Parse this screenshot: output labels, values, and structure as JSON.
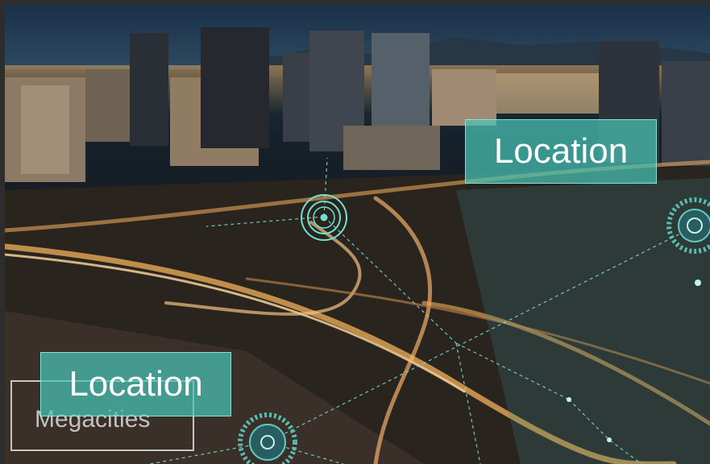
{
  "labels": {
    "location_top": "Location",
    "location_bottom": "Location",
    "megacities": "Megacities"
  },
  "colors": {
    "teal": "#48c4b6",
    "frame": "#2d2d2d"
  },
  "icons": [
    "location-pin-ring-icon",
    "network-node-icon"
  ]
}
